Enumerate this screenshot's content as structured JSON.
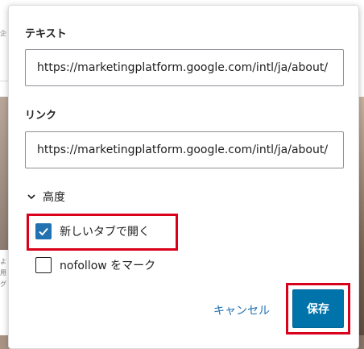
{
  "background": {
    "left_text_top": "企",
    "left_text_bottom": "よ\n用\nグ"
  },
  "link_dialog": {
    "text_label": "テキスト",
    "text_value": "https://marketingplatform.google.com/intl/ja/about/",
    "link_label": "リンク",
    "link_value": "https://marketingplatform.google.com/intl/ja/about/",
    "advanced_label": "高度",
    "new_tab_label": "新しいタブで開く",
    "new_tab_checked": true,
    "nofollow_label": "nofollow をマーク",
    "nofollow_checked": false,
    "cancel_label": "キャンセル",
    "save_label": "保存"
  },
  "colors": {
    "accent": "#2271b1",
    "primary_button": "#0073aa",
    "highlight": "#d9001b"
  },
  "icons": {
    "advanced_toggle": "chevron-down-icon",
    "checkbox_checked": "checkmark-icon"
  }
}
